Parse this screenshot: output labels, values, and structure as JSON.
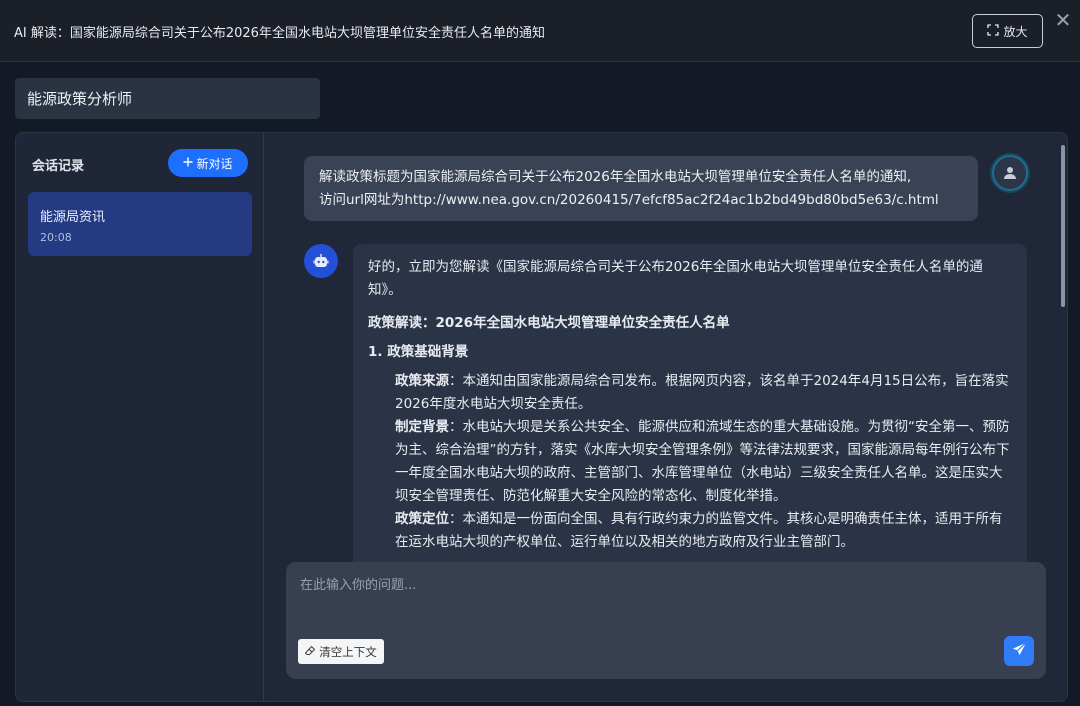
{
  "window": {
    "title": "AI 解读：国家能源局综合司关于公布2026年全国水电站大坝管理单位安全责任人名单的通知",
    "expand_label": "放大",
    "close_symbol": "✕"
  },
  "role": {
    "name": "能源政策分析师"
  },
  "sidebar": {
    "title": "会话记录",
    "new_chat_label": "新对话",
    "conversations": [
      {
        "title": "能源局资讯",
        "time": "20:08"
      }
    ]
  },
  "messages": {
    "user": {
      "line1": "解读政策标题为国家能源局综合司关于公布2026年全国水电站大坝管理单位安全责任人名单的通知,",
      "line2": "访问url网址为http://www.nea.gov.cn/20260415/7efcf85ac2f24ac1b2bd49bd80bd5e63/c.html"
    },
    "assistant": {
      "intro": "好的，立即为您解读《国家能源局综合司关于公布2026年全国水电站大坝管理单位安全责任人名单的通知》。",
      "heading": "政策解读：2026年全国水电站大坝管理单位安全责任人名单",
      "section1_title": "1. 政策基础背景",
      "source_label": "政策来源",
      "source_text": "：本通知由国家能源局综合司发布。根据网页内容，该名单于2024年4月15日公布，旨在落实2026年度水电站大坝安全责任。",
      "background_label": "制定背景",
      "background_text": "：水电站大坝是关系公共安全、能源供应和流域生态的重大基础设施。为贯彻“安全第一、预防为主、综合治理”的方针，落实《水库大坝安全管理条例》等法律法规要求，国家能源局每年例行公布下一年度全国水电站大坝的政府、主管部门、水库管理单位（水电站）三级安全责任人名单。这是压实大坝安全管理责任、防范化解重大安全风险的常态化、制度化举措。",
      "position_label": "政策定位",
      "position_text": "：本通知是一份面向全国、具有行政约束力的监管文件。其核心是明确责任主体，适用于所有在运水电站大坝的产权单位、运行单位以及相关的地方政府及行业主管部门。"
    }
  },
  "input": {
    "placeholder": "在此输入你的问题...",
    "clear_label": "清空上下文"
  }
}
